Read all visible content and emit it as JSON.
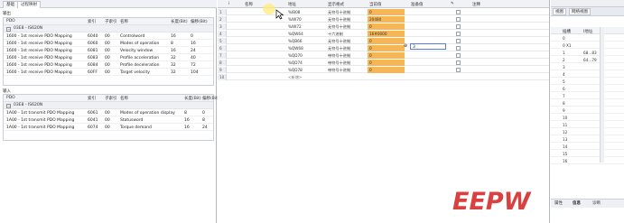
{
  "left": {
    "tabs": [
      "基础",
      "过程映射"
    ],
    "output_label": "输出",
    "input_label": "输入",
    "pdo_columns": [
      "PDO",
      "索引",
      "子索引",
      "名称",
      "长度(Bit)",
      "偏移(Bit)"
    ],
    "output_group": "03E8 - IS620N",
    "output_rows": [
      {
        "pdo": "1600 - 1st receive PDO Mapping",
        "index": "6040",
        "sub": "00",
        "name": "Controlword",
        "len": "16",
        "off": "0"
      },
      {
        "pdo": "1600 - 1st receive PDO Mapping",
        "index": "6060",
        "sub": "00",
        "name": "Modes of operation",
        "len": "8",
        "off": "16"
      },
      {
        "pdo": "1600 - 1st receive PDO Mapping",
        "index": "6081",
        "sub": "00",
        "name": "Velocity window",
        "len": "16",
        "off": "24"
      },
      {
        "pdo": "1600 - 1st receive PDO Mapping",
        "index": "6083",
        "sub": "00",
        "name": "Profile acceleration",
        "len": "32",
        "off": "40"
      },
      {
        "pdo": "1600 - 1st receive PDO Mapping",
        "index": "6084",
        "sub": "00",
        "name": "Profile deceleration",
        "len": "32",
        "off": "72"
      },
      {
        "pdo": "1600 - 1st receive PDO Mapping",
        "index": "60FF",
        "sub": "00",
        "name": "Target velocity",
        "len": "32",
        "off": "104"
      }
    ],
    "input_group": "03E8 - IS620N",
    "input_rows": [
      {
        "pdo": "1A00 - 1st transmit PDO Mapping",
        "index": "6061",
        "sub": "00",
        "name": "Modes of operation display",
        "len": "8",
        "off": "0"
      },
      {
        "pdo": "1A00 - 1st transmit PDO Mapping",
        "index": "6041",
        "sub": "00",
        "name": "Statusword",
        "len": "16",
        "off": "8"
      },
      {
        "pdo": "1A00 - 1st transmit PDO Mapping",
        "index": "6074",
        "sub": "00",
        "name": "Torque demand",
        "len": "16",
        "off": "24"
      }
    ]
  },
  "center": {
    "columns": [
      "名称",
      "地址",
      "显示格式",
      "当前值",
      "准备值",
      "注释"
    ],
    "rows": [
      {
        "num": "1",
        "addr": "%IB08",
        "fmt": "无符号十进制",
        "cur": "0",
        "prep": ""
      },
      {
        "num": "2",
        "addr": "%IW70",
        "fmt": "无符号十进制",
        "cur": "20480",
        "prep": ""
      },
      {
        "num": "3",
        "addr": "%IW72",
        "fmt": "无符号十进制",
        "cur": "0",
        "prep": ""
      },
      {
        "num": "4",
        "addr": "%QW64",
        "fmt": "十六进制",
        "cur": "16#0000",
        "prep": ""
      },
      {
        "num": "5",
        "addr": "%QB66",
        "fmt": "无符号十进制",
        "cur": "0",
        "prep": ""
      },
      {
        "num": "6",
        "addr": "%QW68",
        "fmt": "无符号十进制",
        "cur": "0",
        "prep": "3"
      },
      {
        "num": "7",
        "addr": "%QD70",
        "fmt": "带符号十进制",
        "cur": "0",
        "prep": ""
      },
      {
        "num": "8",
        "addr": "%QD74",
        "fmt": "带符号十进制",
        "cur": "0",
        "prep": ""
      },
      {
        "num": "9",
        "addr": "%QD78",
        "fmt": "带符号十进制",
        "cur": "0",
        "prep": ""
      },
      {
        "num": "10",
        "addr": "<新增>",
        "fmt": "",
        "cur": "",
        "prep": ""
      }
    ],
    "accent": "#f7b656"
  },
  "right": {
    "tabs": [
      "视图",
      "网络视图"
    ],
    "columns": [
      "插槽",
      "I地址"
    ],
    "rows": [
      {
        "slot": "0",
        "addr": ""
      },
      {
        "slot": "0 X1",
        "addr": ""
      },
      {
        "slot": "1",
        "addr": "68...83"
      },
      {
        "slot": "2",
        "addr": "64...79"
      },
      {
        "slot": "3",
        "addr": ""
      },
      {
        "slot": "4",
        "addr": ""
      },
      {
        "slot": "5",
        "addr": ""
      },
      {
        "slot": "6",
        "addr": ""
      },
      {
        "slot": "7",
        "addr": ""
      },
      {
        "slot": "8",
        "addr": ""
      },
      {
        "slot": "9",
        "addr": ""
      },
      {
        "slot": "10",
        "addr": ""
      },
      {
        "slot": "11",
        "addr": ""
      },
      {
        "slot": "12",
        "addr": ""
      },
      {
        "slot": "13",
        "addr": ""
      },
      {
        "slot": "14",
        "addr": ""
      },
      {
        "slot": "15",
        "addr": ""
      },
      {
        "slot": "16",
        "addr": ""
      }
    ],
    "bottom_tabs": [
      "属性",
      "信息",
      "诊断"
    ]
  },
  "watermark": {
    "text": "EEPW"
  }
}
